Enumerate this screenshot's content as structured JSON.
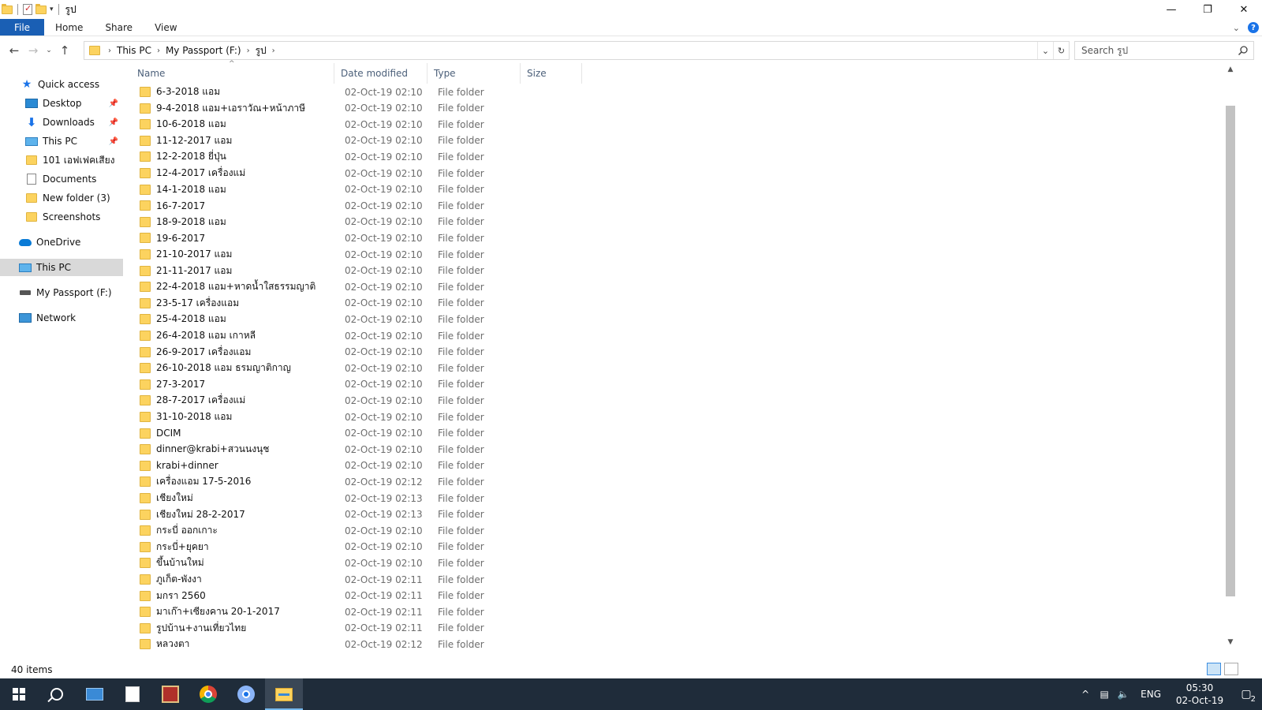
{
  "window": {
    "title": "รูป"
  },
  "ribbon": {
    "tabs": [
      {
        "label": "File"
      },
      {
        "label": "Home"
      },
      {
        "label": "Share"
      },
      {
        "label": "View"
      }
    ]
  },
  "address": {
    "crumbs": [
      "This PC",
      "My Passport (F:)",
      "รูป"
    ]
  },
  "search": {
    "placeholder": "Search รูป"
  },
  "navpane": {
    "quick_access": "Quick access",
    "items": [
      {
        "label": "Desktop",
        "pinned": true
      },
      {
        "label": "Downloads",
        "pinned": true
      },
      {
        "label": "This PC",
        "pinned": true
      },
      {
        "label": "101 เอฟเฟคเสียง",
        "pinned": false
      },
      {
        "label": "Documents",
        "pinned": false
      },
      {
        "label": "New folder (3)",
        "pinned": false
      },
      {
        "label": "Screenshots",
        "pinned": false
      }
    ],
    "onedrive": "OneDrive",
    "this_pc": "This PC",
    "drive": "My Passport (F:)",
    "network": "Network"
  },
  "columns": {
    "name": "Name",
    "date": "Date modified",
    "type": "Type",
    "size": "Size"
  },
  "files": [
    {
      "name": "6-3-2018 แอม",
      "date": "02-Oct-19 02:10",
      "type": "File folder"
    },
    {
      "name": "9-4-2018 แอม+เอราวัณ+หน้าภาษี",
      "date": "02-Oct-19 02:10",
      "type": "File folder"
    },
    {
      "name": "10-6-2018 แอม",
      "date": "02-Oct-19 02:10",
      "type": "File folder"
    },
    {
      "name": "11-12-2017 แอม",
      "date": "02-Oct-19 02:10",
      "type": "File folder"
    },
    {
      "name": "12-2-2018 ยี่ปุ่น",
      "date": "02-Oct-19 02:10",
      "type": "File folder"
    },
    {
      "name": "12-4-2017 เครื่องแม่",
      "date": "02-Oct-19 02:10",
      "type": "File folder"
    },
    {
      "name": "14-1-2018 แอม",
      "date": "02-Oct-19 02:10",
      "type": "File folder"
    },
    {
      "name": "16-7-2017",
      "date": "02-Oct-19 02:10",
      "type": "File folder"
    },
    {
      "name": "18-9-2018 แอม",
      "date": "02-Oct-19 02:10",
      "type": "File folder"
    },
    {
      "name": "19-6-2017",
      "date": "02-Oct-19 02:10",
      "type": "File folder"
    },
    {
      "name": "21-10-2017 แอม",
      "date": "02-Oct-19 02:10",
      "type": "File folder"
    },
    {
      "name": "21-11-2017 แอม",
      "date": "02-Oct-19 02:10",
      "type": "File folder"
    },
    {
      "name": "22-4-2018 แอม+หาดน้ำใสธรรมญาติ",
      "date": "02-Oct-19 02:10",
      "type": "File folder"
    },
    {
      "name": "23-5-17 เครื่องแอม",
      "date": "02-Oct-19 02:10",
      "type": "File folder"
    },
    {
      "name": "25-4-2018 แอม",
      "date": "02-Oct-19 02:10",
      "type": "File folder"
    },
    {
      "name": "26-4-2018 แอม เกาหลี",
      "date": "02-Oct-19 02:10",
      "type": "File folder"
    },
    {
      "name": "26-9-2017 เครื่องแอม",
      "date": "02-Oct-19 02:10",
      "type": "File folder"
    },
    {
      "name": "26-10-2018 แอม ธรมญาติกาญ",
      "date": "02-Oct-19 02:10",
      "type": "File folder"
    },
    {
      "name": "27-3-2017",
      "date": "02-Oct-19 02:10",
      "type": "File folder"
    },
    {
      "name": "28-7-2017 เครื่องแม่",
      "date": "02-Oct-19 02:10",
      "type": "File folder"
    },
    {
      "name": "31-10-2018 แอม",
      "date": "02-Oct-19 02:10",
      "type": "File folder"
    },
    {
      "name": "DCIM",
      "date": "02-Oct-19 02:10",
      "type": "File folder"
    },
    {
      "name": "dinner@krabi+สวนนงนุช",
      "date": "02-Oct-19 02:10",
      "type": "File folder"
    },
    {
      "name": "krabi+dinner",
      "date": "02-Oct-19 02:10",
      "type": "File folder"
    },
    {
      "name": "เครื่องแอม 17-5-2016",
      "date": "02-Oct-19 02:12",
      "type": "File folder"
    },
    {
      "name": "เชียงใหม่",
      "date": "02-Oct-19 02:13",
      "type": "File folder"
    },
    {
      "name": "เชียงใหม่ 28-2-2017",
      "date": "02-Oct-19 02:13",
      "type": "File folder"
    },
    {
      "name": "กระบี่ ออกเกาะ",
      "date": "02-Oct-19 02:10",
      "type": "File folder"
    },
    {
      "name": "กระบี่+ยุคยา",
      "date": "02-Oct-19 02:10",
      "type": "File folder"
    },
    {
      "name": "ขึ้นบ้านใหม่",
      "date": "02-Oct-19 02:10",
      "type": "File folder"
    },
    {
      "name": "ภูเก็ต-พังงา",
      "date": "02-Oct-19 02:11",
      "type": "File folder"
    },
    {
      "name": "มกรา 2560",
      "date": "02-Oct-19 02:11",
      "type": "File folder"
    },
    {
      "name": "มาเก๊า+เซียงคาน 20-1-2017",
      "date": "02-Oct-19 02:11",
      "type": "File folder"
    },
    {
      "name": "รูปบ้าน+งานเที่ยวไทย",
      "date": "02-Oct-19 02:11",
      "type": "File folder"
    },
    {
      "name": "หลวงตา",
      "date": "02-Oct-19 02:12",
      "type": "File folder"
    }
  ],
  "status": {
    "count": "40 items"
  },
  "taskbar": {
    "lang": "ENG",
    "time": "05:30",
    "date": "02-Oct-19",
    "notifications": "2"
  }
}
